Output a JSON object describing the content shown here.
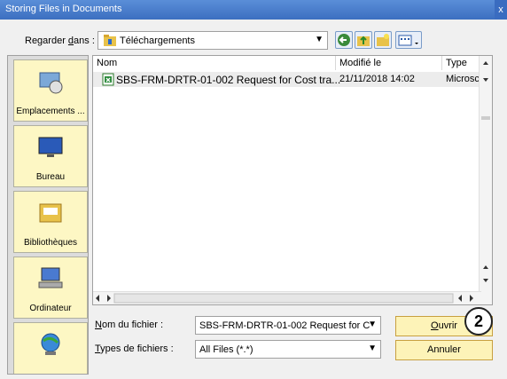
{
  "window": {
    "title": "Storing Files in Documents",
    "close_glyph": "x"
  },
  "lookin": {
    "label_prefix": "Regarder ",
    "label_u": "d",
    "label_suffix": "ans :",
    "value": "Téléchargements"
  },
  "places": [
    {
      "label": "Emplacements ..."
    },
    {
      "label": "Bureau"
    },
    {
      "label": "Bibliothèques"
    },
    {
      "label": "Ordinateur"
    },
    {
      "label": ""
    }
  ],
  "columns": {
    "name": "Nom",
    "modified": "Modifié le",
    "type": "Type"
  },
  "files": [
    {
      "name": "SBS-FRM-DRTR-01-002 Request for Cost tra...",
      "modified": "21/11/2018 14:02",
      "type": "Microsc"
    }
  ],
  "filename": {
    "label_u": "N",
    "label_rest": "om du fichier :",
    "value": "SBS-FRM-DRTR-01-002 Request for C"
  },
  "filetype": {
    "label_u": "T",
    "label_rest": "ypes de fichiers :",
    "value": "All Files (*.*)"
  },
  "buttons": {
    "open_u": "O",
    "open_rest": "uvrir",
    "cancel": "Annuler"
  },
  "annotation": {
    "number": "2"
  }
}
